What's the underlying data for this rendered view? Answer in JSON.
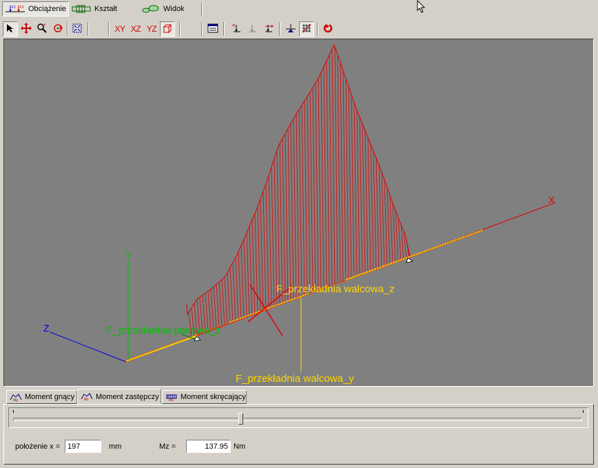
{
  "mode_tabs": [
    {
      "label": "Obciążenie",
      "icon": "load-forces-icon",
      "active": true
    },
    {
      "label": "Kształt",
      "icon": "shaft-shape-icon",
      "active": false
    },
    {
      "label": "Widok",
      "icon": "shaft-view-icon",
      "active": false
    }
  ],
  "toolbar": {
    "select": "select-arrow-icon",
    "pan": "pan-move-icon",
    "zoom": "zoom-icon",
    "rotate": "rotate-icon",
    "fit": "zoom-fit-icon",
    "plane_xy": "XY",
    "plane_xz": "XZ",
    "plane_yz": "YZ",
    "iso": "iso-view-icon",
    "list": "list-icon",
    "add_force": "add-force-icon",
    "edit_force": "edit-force-icon",
    "move_force": "move-force-icon",
    "support": "support-icon",
    "grid": "grid-icon",
    "refresh": "refresh-icon"
  },
  "view": {
    "axis_x": "X",
    "axis_y": "Y",
    "axis_z": "Z",
    "label_belt_z": "F_przekładnia pasowa_z",
    "label_gear_z": "F_przekładnia walcowa_z",
    "label_gear_y": "F_przekładnia walcowa_y",
    "colors": {
      "background": "#808080",
      "moment": "#e00000",
      "shaft": "#ffd700",
      "x_axis": "#e00000",
      "y_axis": "#00c000",
      "z_axis": "#0000e0"
    }
  },
  "bottom_tabs": [
    {
      "label": "Moment gnący",
      "active": false
    },
    {
      "label": "Moment zastępczy",
      "active": true
    },
    {
      "label": "Moment skręcający",
      "active": false
    }
  ],
  "panel": {
    "position_label": "położenie x =",
    "position_value": "197",
    "position_unit": "mm",
    "moment_label": "Mz =",
    "moment_value": "137.95",
    "moment_unit": "Nm",
    "slider_fraction": 0.4
  }
}
